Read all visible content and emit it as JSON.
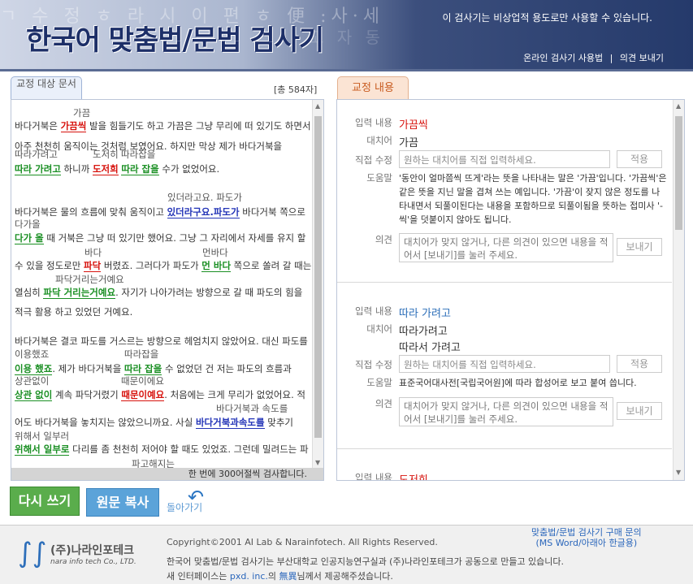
{
  "header": {
    "bg_chars": "ㄱ 수 정 ㅎ 라 시 이 편 ㅎ 便 :사·세",
    "bg_chars2": "고 자 동",
    "title": "한국어 맞춤법/문법 검사기",
    "notice": "이 검사기는 비상업적 용도로만 사용할 수 있습니다.",
    "link_usage": "온라인 검사기 사용법",
    "link_sep": "|",
    "link_feedback": "의견 보내기"
  },
  "left": {
    "tab_label": "교정 대상 문서",
    "total_count": "[총 584자]",
    "footer_note": "한 번에 300어절씩 검사합니다.",
    "lines": [
      {
        "pre": "바다거북은 ",
        "err": "가끔씩",
        "cls": "er",
        "post": " 발을 힘들기도 하고 가끔은 그냥 무리에 떠 있기도 하면서"
      },
      {
        "pre": "아주 천천히 움직이는 것처럼 보였어요. 하지만 막상 제가 바다거북을",
        "err": "",
        "cls": "",
        "post": ""
      },
      {
        "pre": "",
        "err": "따라 가려고",
        "cls": "gr",
        "post": " 하니까 ",
        "err2": "도저희",
        "cls2": "er",
        "mid2": " ",
        "err3": "따라 잡을",
        "cls3": "gr",
        "post3": " 수가 없었어요."
      },
      {
        "pre": "바다거북은 물의 흐름에 맞춰 움직이고 ",
        "err": "있더라구요.파도가",
        "cls": "bl",
        "post": " 바다거북 쪽으로"
      },
      {
        "pre": "",
        "err": "다가 올",
        "cls": "gr",
        "post": " 때 거북은 그냥 떠 있기만 했어요. 그냥 그 자리에서 자세를 유지 할"
      },
      {
        "pre": "수 있을 정도로만 ",
        "err": "파닥",
        "cls": "er",
        "post": " 버렸죠. 그러다가 파도가 ",
        "err2": "먼 바다",
        "cls2": "gr",
        "post2": " 쪽으로 쏠려 갈 때는"
      },
      {
        "pre": "열심히 ",
        "err": "파닥 거리는거예요",
        "cls": "gr",
        "post": ". 자기가 나아가려는 방향으로 갈 때 파도의 힘을"
      },
      {
        "pre": "적극 활용 하고 있었던 거예요.",
        "err": "",
        "cls": "",
        "post": ""
      },
      {
        "pre": "바다거북은 결코 파도를 거스르는 방향으로 헤엄치지 않았어요. 대신 파도를",
        "err": "",
        "cls": "",
        "post": ""
      },
      {
        "pre": "",
        "err": "이용 했죠",
        "cls": "gr",
        "post": ". 제가 바다거북을 ",
        "err2": "따라 잡을",
        "cls2": "gr",
        "post2": " 수 없었던 건 저는 파도의 흐름과"
      },
      {
        "pre": "",
        "err": "상관 없이",
        "cls": "gr",
        "post": " 계속 파닥거렸기 ",
        "err2": "때문이예요",
        "cls2": "er",
        "post2": ". 처음에는 크게 무리가 없었어요. 적"
      },
      {
        "pre": "어도 바다거북을 놓치지는 않았으니까요. 사실 ",
        "err": "바다거북과속도를",
        "cls": "bl",
        "post": " 맞추기"
      },
      {
        "pre": "",
        "err": "위해서 일부로",
        "cls": "gr",
        "post": " 다리를 좀 천천히 저어야 할 때도 있었죠. 그런데 밀려드는 파"
      }
    ],
    "suggestions": [
      "가끔",
      "따라가려고",
      "도저히",
      "따라잡을",
      "있더라고요. 파도가",
      "다가올",
      "바다",
      "먼바다",
      "파닥거리는거예요",
      "이용했죠",
      "따라잡을",
      "상관없이",
      "때문이에요",
      "바다거북과 속도를",
      "위해서 일부러",
      "파고해지는"
    ]
  },
  "right": {
    "tab_label": "교정 내용",
    "cards": [
      {
        "label_input": "입력 내용",
        "input": "가끔씩",
        "label_replace": "대치어",
        "replace": [
          "가끔"
        ],
        "label_direct": "직접 수정",
        "direct_placeholder": "원하는 대치어를 직접 입력하세요.",
        "apply": "적용",
        "label_help": "도움말",
        "help": "'동안이 얼마쯤씩 뜨게'라는 뜻을 나타내는 말은 '가끔'입니다. '가끔씩'은 같은 뜻을 지닌 말을 겹쳐 쓰는 예입니다. '가끔'이 잦지 않은 정도를 나타내면서 되풀이된다는 내용을 포함하므로 되풀이됨을 뜻하는 접미사 '-씩'을 덧붙이지 않아도 됩니다.",
        "label_opinion": "의견",
        "opinion_placeholder": "대치어가 맞지 않거나, 다른 의견이 있으면 내용을 적어서 [보내기]를 눌러 주세요.",
        "send": "보내기"
      },
      {
        "label_input": "입력 내용",
        "input": "따라 가려고",
        "label_replace": "대치어",
        "replace": [
          "따라가려고",
          "따라서 가려고"
        ],
        "label_direct": "직접 수정",
        "direct_placeholder": "원하는 대치어를 직접 입력하세요.",
        "apply": "적용",
        "label_help": "도움말",
        "help": "표준국어대사전[국립국어원]에 따라 합성어로 보고 붙여 씁니다.",
        "label_opinion": "의견",
        "opinion_placeholder": "대치어가 맞지 않거나, 다른 의견이 있으면 내용을 적어서 [보내기]를 눌러 주세요.",
        "send": "보내기"
      },
      {
        "label_input": "입력 내용",
        "input": "도저희"
      }
    ]
  },
  "buttons": {
    "rewrite": "다시 쓰기",
    "copy": "원문 복사",
    "back": "돌아가기"
  },
  "footer": {
    "logo_name": "(주)나라인포테크",
    "logo_sub": "nara info tech Co., LTD.",
    "copyright": "Copyright©2001 AI Lab & Narainfotech. All Rights Reserved.",
    "purchase_line1": "맞춤법/문법 검사기 구매 문의",
    "purchase_line2": "(MS Word/아래아 한글용)",
    "line1": "한국어 맞춤법/문법 검사기는 부산대학교 인공지능연구실과 (주)나라인포테크가 공동으로 만들고 있습니다.",
    "line2_pre": "새 인터페이스는 ",
    "line2_link": "pxd. inc.",
    "line2_mid": "의 ",
    "line2_name": "無異",
    "line2_post": "님께서 제공해주셨습니다."
  }
}
